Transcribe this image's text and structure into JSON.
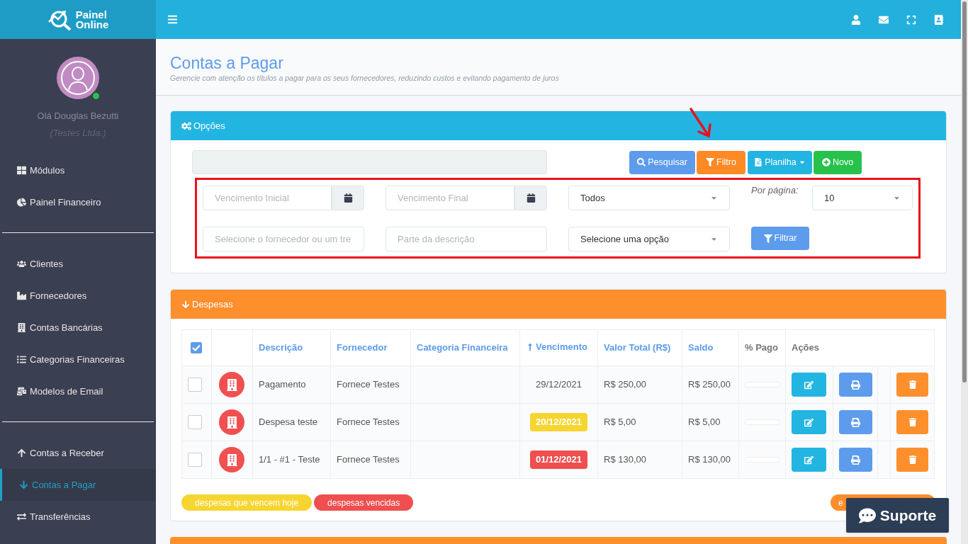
{
  "logo": {
    "line1": "Painel",
    "line2": "Online"
  },
  "user": {
    "greeting": "Olá Douglas Bezutti",
    "company": "(Testes Ltda.)",
    "online": true
  },
  "sidebar": {
    "groups": [
      [
        {
          "label": "Módulos",
          "selected": false
        },
        {
          "label": "Painel Financeiro",
          "selected": false
        }
      ],
      [
        {
          "label": "Clientes",
          "selected": false
        },
        {
          "label": "Fornecedores",
          "selected": false
        },
        {
          "label": "Contas Bancárias",
          "selected": false
        },
        {
          "label": "Categorias Financeiras",
          "selected": false
        },
        {
          "label": "Modelos de Email",
          "selected": false
        }
      ],
      [
        {
          "label": "Contas a Receber",
          "selected": false
        },
        {
          "label": "Contas a Pagar",
          "selected": true
        },
        {
          "label": "Transferências",
          "selected": false
        }
      ]
    ]
  },
  "page": {
    "title": "Contas a Pagar",
    "subtitle": "Gerencie com atenção os títulos a pagar para os seus fornecedores, reduzindo custos e evitando pagamento de juros"
  },
  "options_panel": {
    "title": "Opções",
    "buttons": [
      {
        "label": "Pesquisar",
        "kind": "search"
      },
      {
        "label": "Filtro",
        "kind": "filter"
      },
      {
        "label": "Planilha",
        "kind": "sheet"
      },
      {
        "label": "Novo",
        "kind": "new"
      }
    ],
    "filters": {
      "start_date": {
        "placeholder": "Vencimento Inicial"
      },
      "end_date": {
        "placeholder": "Vencimento Final"
      },
      "status_select": "Todos",
      "per_page_label": "Por página:",
      "per_page": "10",
      "supplier": {
        "placeholder": "Selecione o fornecedor ou um tre"
      },
      "description": {
        "placeholder": "Parte da descrição"
      },
      "option_select": "Selecione uma opção",
      "apply_button": "Filtrar"
    }
  },
  "expenses_panel": {
    "title": "Despesas",
    "table": {
      "all_checked": true,
      "columns": [
        "Descrição",
        "Fornecedor",
        "Categoria Financeira",
        "Vencimento",
        "Valor Total (R$)",
        "Saldo",
        "% Pago",
        "Ações"
      ],
      "rows": [
        {
          "checked": false,
          "description": "Pagamento",
          "supplier": "Fornece Testes",
          "due": "29/12/2021",
          "due_today": false,
          "overdue": false,
          "total": "R$ 250,00",
          "balance": "R$ 250,00",
          "level": 0
        },
        {
          "checked": false,
          "description": "Despesa teste",
          "supplier": "Fornece Testes",
          "due": "20/12/2021",
          "due_today": true,
          "overdue": false,
          "total": "R$ 5,00",
          "balance": "R$ 5,00",
          "level": 0
        },
        {
          "checked": false,
          "description": "1/1 - #1 - Teste",
          "supplier": "Fornece Testes",
          "due": "01/12/2021",
          "due_today": false,
          "overdue": true,
          "total": "R$ 130,00",
          "balance": "R$ 130,00",
          "level": 0
        }
      ]
    },
    "legend": [
      {
        "label": "despesas que vencem hoje",
        "color": "#f7d531"
      },
      {
        "label": "despesas vencidas",
        "color": "#ef4f4f"
      },
      {
        "label": "e",
        "color": "#fd8d2a"
      }
    ]
  },
  "support_button": "Suporte"
}
